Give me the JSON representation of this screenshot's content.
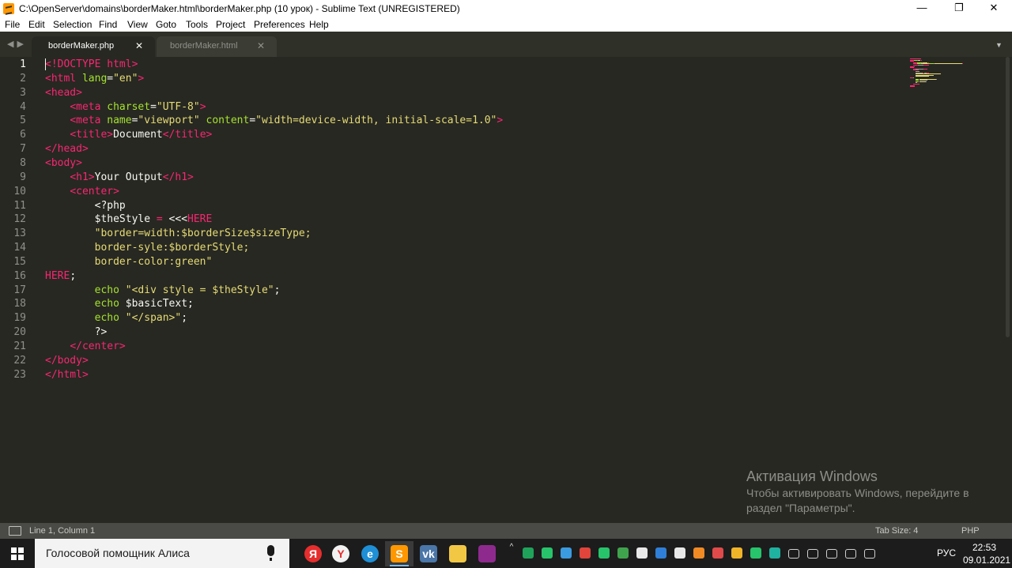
{
  "window": {
    "title": "C:\\OpenServer\\domains\\borderMaker.html\\borderMaker.php (10 урок) - Sublime Text (UNREGISTERED)",
    "minimize": "—",
    "maximize": "❐",
    "close": "✕"
  },
  "menu": [
    "File",
    "Edit",
    "Selection",
    "Find",
    "View",
    "Goto",
    "Tools",
    "Project",
    "Preferences",
    "Help"
  ],
  "tabs": [
    {
      "label": "borderMaker.php",
      "active": true
    },
    {
      "label": "borderMaker.html",
      "active": false
    }
  ],
  "tab_close_glyph": "✕",
  "nav_arrows": "◀▶",
  "tab_dropdown": "▼",
  "editor": {
    "current_line": 1,
    "lines": [
      [
        [
          "tag",
          "<!DOCTYPE html>"
        ]
      ],
      [
        [
          "tag",
          "<html "
        ],
        [
          "attr",
          "lang"
        ],
        [
          "php",
          "="
        ],
        [
          "str",
          "\"en\""
        ],
        [
          "tag",
          ">"
        ]
      ],
      [
        [
          "tag",
          "<head>"
        ]
      ],
      [
        [
          "php",
          "    "
        ],
        [
          "tag",
          "<meta "
        ],
        [
          "attr",
          "charset"
        ],
        [
          "php",
          "="
        ],
        [
          "str",
          "\"UTF-8\""
        ],
        [
          "tag",
          ">"
        ]
      ],
      [
        [
          "php",
          "    "
        ],
        [
          "tag",
          "<meta "
        ],
        [
          "attr",
          "name"
        ],
        [
          "php",
          "="
        ],
        [
          "str",
          "\"viewport\" "
        ],
        [
          "attr",
          "content"
        ],
        [
          "php",
          "="
        ],
        [
          "str",
          "\"width=device-width, initial-scale=1.0\""
        ],
        [
          "tag",
          ">"
        ]
      ],
      [
        [
          "php",
          "    "
        ],
        [
          "tag",
          "<title>"
        ],
        [
          "php",
          "Document"
        ],
        [
          "tag",
          "</title>"
        ]
      ],
      [
        [
          "tag",
          "</head>"
        ]
      ],
      [
        [
          "tag",
          "<body>"
        ]
      ],
      [
        [
          "php",
          "    "
        ],
        [
          "tag",
          "<h1>"
        ],
        [
          "php",
          "Your Output"
        ],
        [
          "tag",
          "</h1>"
        ]
      ],
      [
        [
          "php",
          "    "
        ],
        [
          "tag",
          "<center>"
        ]
      ],
      [
        [
          "php",
          "        <?php"
        ]
      ],
      [
        [
          "php",
          "        $theStyle "
        ],
        [
          "tag",
          "="
        ],
        [
          "php",
          " <<<"
        ],
        [
          "tag",
          "HERE"
        ]
      ],
      [
        [
          "str",
          "        \"border=width:$borderSize$sizeType;"
        ]
      ],
      [
        [
          "str",
          "        border-syle:$borderStyle;"
        ]
      ],
      [
        [
          "str",
          "        border-color:green\""
        ]
      ],
      [
        [
          "tag",
          "HERE"
        ],
        [
          "php",
          ";"
        ]
      ],
      [
        [
          "php",
          "        "
        ],
        [
          "attr",
          "echo"
        ],
        [
          "php",
          " "
        ],
        [
          "str",
          "\"<div style = $theStyle\""
        ],
        [
          "php",
          ";"
        ]
      ],
      [
        [
          "php",
          "        "
        ],
        [
          "attr",
          "echo"
        ],
        [
          "php",
          " $basicText;"
        ]
      ],
      [
        [
          "php",
          "        "
        ],
        [
          "attr",
          "echo"
        ],
        [
          "php",
          " "
        ],
        [
          "str",
          "\"</span>\""
        ],
        [
          "php",
          ";"
        ]
      ],
      [
        [
          "php",
          "        ?>"
        ]
      ],
      [
        [
          "php",
          "    "
        ],
        [
          "tag",
          "</center>"
        ]
      ],
      [
        [
          "tag",
          "</body>"
        ]
      ],
      [
        [
          "tag",
          "</html>"
        ]
      ]
    ]
  },
  "watermark": {
    "title": "Активация Windows",
    "line1": "Чтобы активировать Windows, перейдите в",
    "line2": "раздел \"Параметры\"."
  },
  "status": {
    "position": "Line 1, Column 1",
    "tab_size": "Tab Size: 4",
    "syntax": "PHP"
  },
  "taskbar": {
    "search_text": "Голосовой помощник Алиса",
    "apps": [
      {
        "name": "yandex-app",
        "glyph": "Я",
        "color": "#e62e2e"
      },
      {
        "name": "yandex-browser",
        "glyph": "Y",
        "color": "#f2f2f2"
      },
      {
        "name": "edge",
        "glyph": "e",
        "color": "#1f8fd6"
      },
      {
        "name": "sublime-text",
        "glyph": "S",
        "color": "#ff9800",
        "active": true
      },
      {
        "name": "vk",
        "glyph": "vk",
        "color": "#4a76a8"
      },
      {
        "name": "file-explorer",
        "glyph": "",
        "color": "#f2c744"
      },
      {
        "name": "winrar",
        "glyph": "",
        "color": "#8e2a8e"
      }
    ],
    "language": "РУС",
    "time": "22:53",
    "date": "09.01.2021",
    "tray_chevron": "^"
  },
  "colors": {
    "editor_bg": "#272822",
    "keyword_tag": "#f92672",
    "attribute": "#a6e22e",
    "string": "#e6db74",
    "text": "#f8f8f2"
  }
}
